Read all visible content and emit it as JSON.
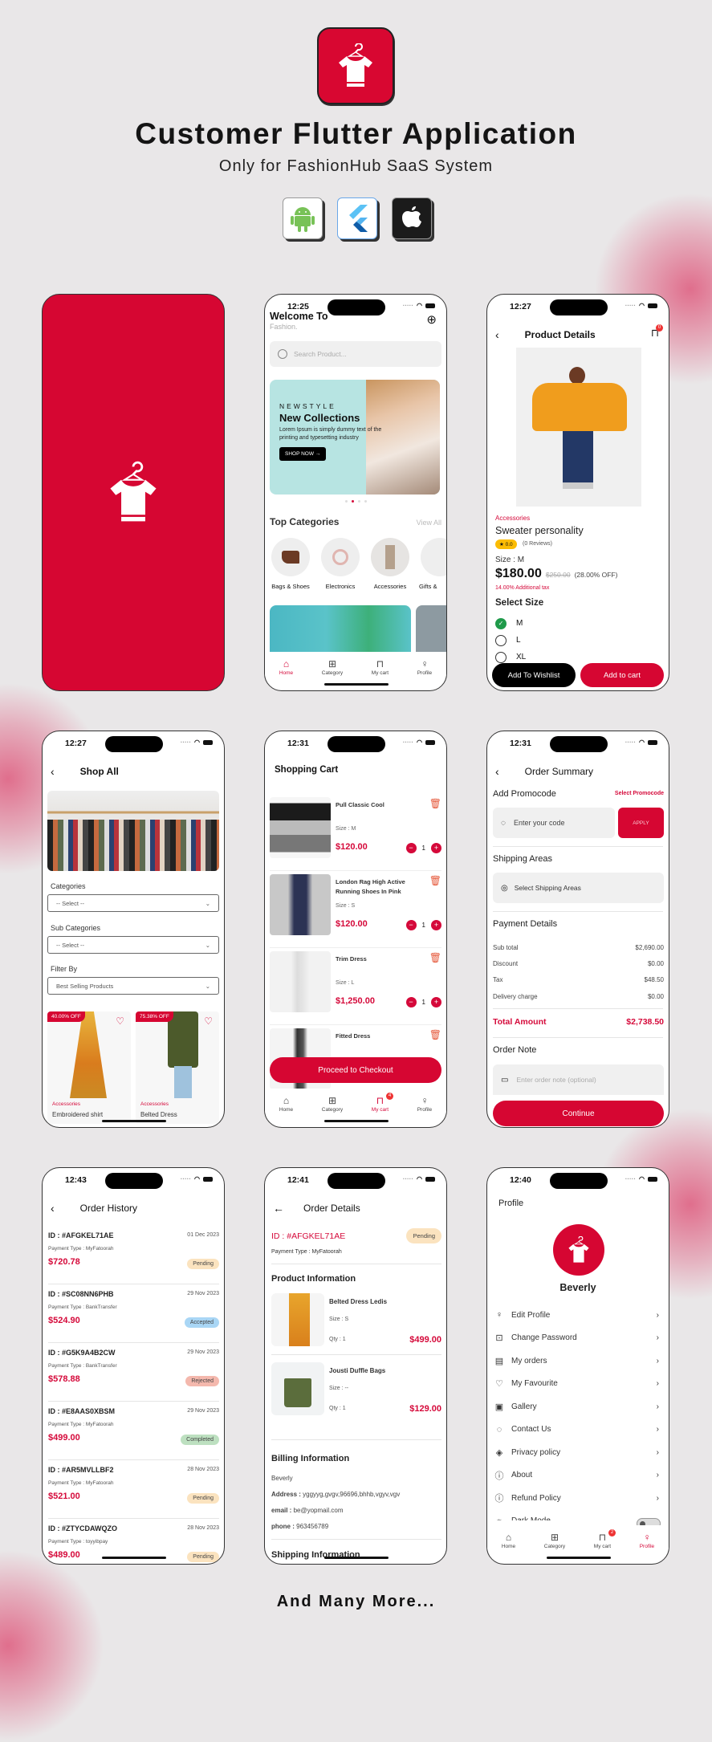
{
  "hero": {
    "title": "Customer Flutter Application",
    "subtitle": "Only for FashionHub SaaS System",
    "brand_color": "#d80731",
    "platforms": [
      "android-icon",
      "flutter-icon",
      "apple-icon"
    ],
    "footer": "And Many More..."
  },
  "status_times": {
    "home": "12:25",
    "product": "12:27",
    "shop": "12:27",
    "cart": "12:31",
    "summary": "12:31",
    "history": "12:43",
    "details": "12:41",
    "profile": "12:40"
  },
  "home": {
    "welcome": "Welcome To",
    "brand": "Fashion.",
    "search_placeholder": "Search Product...",
    "banner": {
      "eyebrow": "NEWSTYLE",
      "title": "New Collections",
      "desc": "Lorem Ipsum is simply dummy text of the printing and typesetting industry",
      "cta": "SHOP NOW →"
    },
    "section_title": "Top Categories",
    "view_all": "View All",
    "categories": [
      "Bags & Shoes",
      "Electronics",
      "Accessories",
      "Gifts &"
    ]
  },
  "tabbar": {
    "home": "Home",
    "category": "Category",
    "cart": "My cart",
    "profile": "Profile",
    "cart_badge_cart_screen": "4",
    "cart_badge_profile_screen": "2",
    "cart_badge_home_screen": ""
  },
  "product": {
    "title": "Product Details",
    "cart_badge": "0",
    "category": "Accessories",
    "name": "Sweater personality",
    "rating": "0.0",
    "reviews": "(0 Reviews)",
    "size": "Size : M",
    "price": "$180.00",
    "old_price": "$250.00",
    "discount": "(28.00% OFF)",
    "tax": "14.00% Additional tax",
    "select_size": "Select Size",
    "sizes": [
      {
        "label": "M",
        "selected": true
      },
      {
        "label": "L",
        "selected": false
      },
      {
        "label": "XL",
        "selected": false
      }
    ],
    "wishlist_btn": "Add To Wishlist",
    "cart_btn": "Add to cart"
  },
  "shop": {
    "title": "Shop All",
    "categories_label": "Categories",
    "categories_value": "-- Select --",
    "sub_label": "Sub Categories",
    "sub_value": "-- Select --",
    "filter_label": "Filter By",
    "filter_value": "Best Selling Products",
    "products": [
      {
        "discount": "40.00% OFF",
        "category": "Accessories",
        "name": "Embroidered shirt"
      },
      {
        "discount": "75.38% OFF",
        "category": "Accessories",
        "name": "Belted Dress"
      }
    ]
  },
  "cart": {
    "title": "Shopping Cart",
    "items": [
      {
        "name": "Pull Classic Cool",
        "size": "Size : M",
        "price": "$120.00",
        "qty": "1"
      },
      {
        "name": "London Rag High Active Running Shoes In Pink",
        "size": "Size : S",
        "price": "$120.00",
        "qty": "1"
      },
      {
        "name": "Trim Dress",
        "size": "Size : L",
        "price": "$1,250.00",
        "qty": "1"
      },
      {
        "name": "Fitted Dress",
        "size": "",
        "price": "",
        "qty": ""
      }
    ],
    "checkout": "Proceed to Checkout"
  },
  "summary": {
    "title": "Order Summary",
    "promo_label": "Add Promocode",
    "promo_link": "Select Promocode",
    "promo_placeholder": "Enter your code",
    "apply": "APPLY",
    "shipping_label": "Shipping Areas",
    "shipping_placeholder": "Select Shipping Areas",
    "payment_label": "Payment Details",
    "lines": [
      {
        "label": "Sub total",
        "value": "$2,690.00"
      },
      {
        "label": "Discount",
        "value": "$0.00"
      },
      {
        "label": "Tax",
        "value": "$48.50"
      },
      {
        "label": "Delivery charge",
        "value": "$0.00"
      }
    ],
    "total_label": "Total Amount",
    "total_value": "$2,738.50",
    "note_label": "Order Note",
    "note_placeholder": "Enter order note (optional)",
    "continue": "Continue"
  },
  "history": {
    "title": "Order History",
    "orders": [
      {
        "id": "ID : #AFGKEL71AE",
        "date": "01 Dec 2023",
        "payment": "Payment Type : MyFatoorah",
        "amount": "$720.78",
        "status": "Pending",
        "status_color": "#fbe3bf"
      },
      {
        "id": "ID : #SC08NN6PHB",
        "date": "29 Nov 2023",
        "payment": "Payment Type : BankTransfer",
        "amount": "$524.90",
        "status": "Accepted",
        "status_color": "#a9d6f5"
      },
      {
        "id": "ID : #G5K9A4B2CW",
        "date": "29 Nov 2023",
        "payment": "Payment Type : BankTransfer",
        "amount": "$578.88",
        "status": "Rejected",
        "status_color": "#f4b8ad"
      },
      {
        "id": "ID : #E8AAS0XBSM",
        "date": "29 Nov 2023",
        "payment": "Payment Type : MyFatoorah",
        "amount": "$499.00",
        "status": "Completed",
        "status_color": "#bde0c0"
      },
      {
        "id": "ID : #AR5MVLLBF2",
        "date": "28 Nov 2023",
        "payment": "Payment Type : MyFatoorah",
        "amount": "$521.00",
        "status": "Pending",
        "status_color": "#fbe3bf"
      },
      {
        "id": "ID : #ZTYCDAWQZO",
        "date": "28 Nov 2023",
        "payment": "Payment Type : toyyibpay",
        "amount": "$489.00",
        "status": "Pending",
        "status_color": "#fbe3bf"
      }
    ]
  },
  "details": {
    "title": "Order Details",
    "id": "ID : #AFGKEL71AE",
    "status": "Pending",
    "payment": "Payment Type : MyFatoorah",
    "product_section": "Product Information",
    "products": [
      {
        "name": "Belted Dress Ledis",
        "size": "Size : S",
        "qty": "Qty : 1",
        "price": "$499.00"
      },
      {
        "name": "Jousti Duffle Bags",
        "size": "Size : --",
        "qty": "Qty : 1",
        "price": "$129.00"
      }
    ],
    "billing_section": "Billing Information",
    "billing_name": "Beverly",
    "address_label": "Address :",
    "address": "yggyyg,gvgv,96696,bhhb,vgyv,vgv",
    "email_label": "email :",
    "email": "be@yopmail.com",
    "phone_label": "phone :",
    "phone": "963456789",
    "shipping_section": "Shipping Information"
  },
  "profile": {
    "title": "Profile",
    "name": "Beverly",
    "menu": [
      {
        "label": "Edit Profile",
        "icon": "user-icon"
      },
      {
        "label": "Change Password",
        "icon": "lock-icon"
      },
      {
        "label": "My orders",
        "icon": "clipboard-icon"
      },
      {
        "label": "My Favourite",
        "icon": "heart-icon"
      },
      {
        "label": "Gallery",
        "icon": "image-icon"
      },
      {
        "label": "Contact Us",
        "icon": "chat-icon"
      },
      {
        "label": "Privacy policy",
        "icon": "shield-icon"
      },
      {
        "label": "About",
        "icon": "info-icon"
      },
      {
        "label": "Refund Policy",
        "icon": "alert-icon"
      },
      {
        "label": "Dark Mode",
        "icon": "sun-icon"
      }
    ]
  }
}
